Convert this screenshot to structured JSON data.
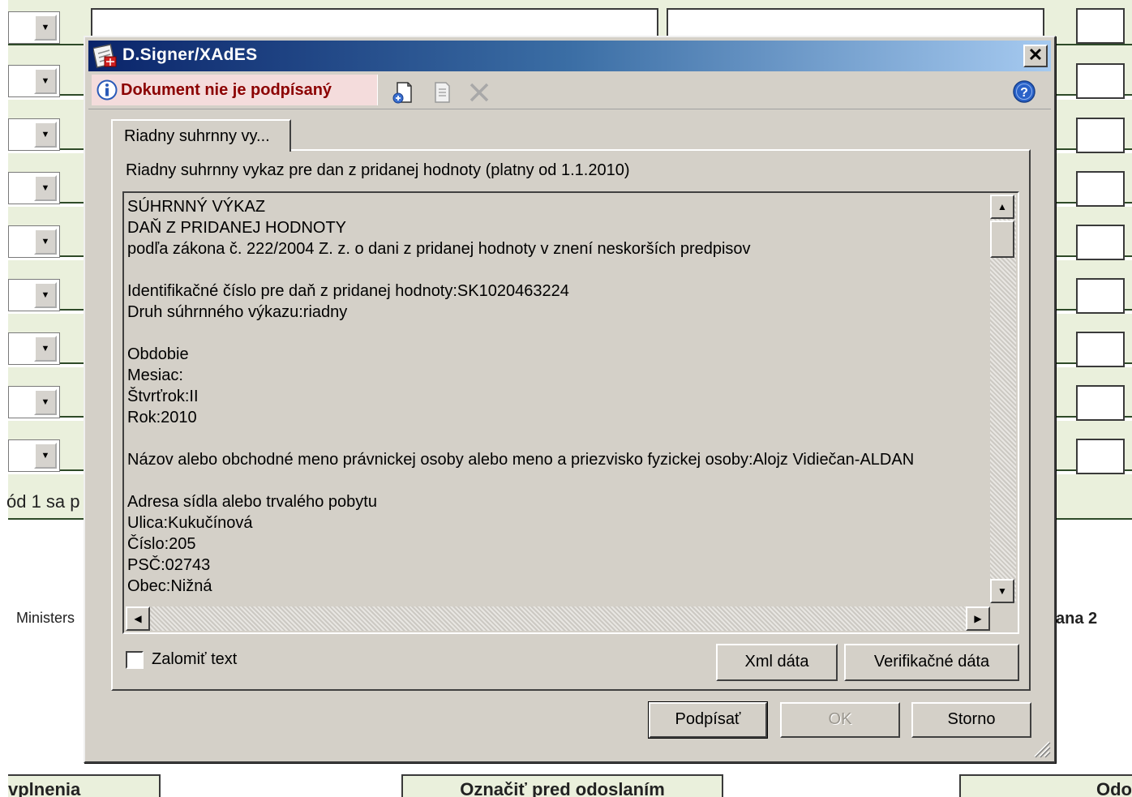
{
  "background": {
    "fragment_left": "ód 1 sa p",
    "footer_left": "Ministers",
    "footer_right": "ana 2",
    "bottom_buttons": [
      "vplnenia",
      "Označiť pred odoslaním",
      "Odo"
    ]
  },
  "dialog": {
    "title": "D.Signer/XAdES",
    "close_label": "✕",
    "status": "Dokument nie je podpísaný",
    "icons": [
      "add-document-icon",
      "document-icon",
      "delete-icon",
      "help-icon"
    ],
    "tab_label": "Riadny suhrnny vy...",
    "heading": "Riadny suhrnny vykaz pre dan z pridanej hodnoty (platny od 1.1.2010)",
    "content_lines": [
      "SÚHRNNÝ VÝKAZ",
      "DAŇ Z PRIDANEJ HODNOTY",
      "podľa zákona č. 222/2004 Z. z. o dani z pridanej hodnoty v znení neskorších predpisov",
      "",
      "Identifikačné číslo pre daň z pridanej hodnoty:SK1020463224",
      "Druh súhrnného výkazu:riadny",
      "",
      "Obdobie",
      "Mesiac:",
      "Štvrťrok:II",
      "Rok:2010",
      "",
      "Názov alebo obchodné meno právnickej osoby alebo meno a priezvisko fyzickej osoby:Alojz Vidiečan-ALDAN",
      "",
      "Adresa sídla alebo trvalého pobytu",
      "Ulica:Kukučínová",
      "Číslo:205",
      "PSČ:02743",
      "Obec:Nižná"
    ],
    "wrap_checkbox": {
      "label": "Zalomiť text",
      "checked": false
    },
    "buttons": {
      "xml": "Xml dáta",
      "verify": "Verifikačné dáta",
      "sign": "Podpísať",
      "ok": "OK",
      "cancel": "Storno"
    }
  }
}
